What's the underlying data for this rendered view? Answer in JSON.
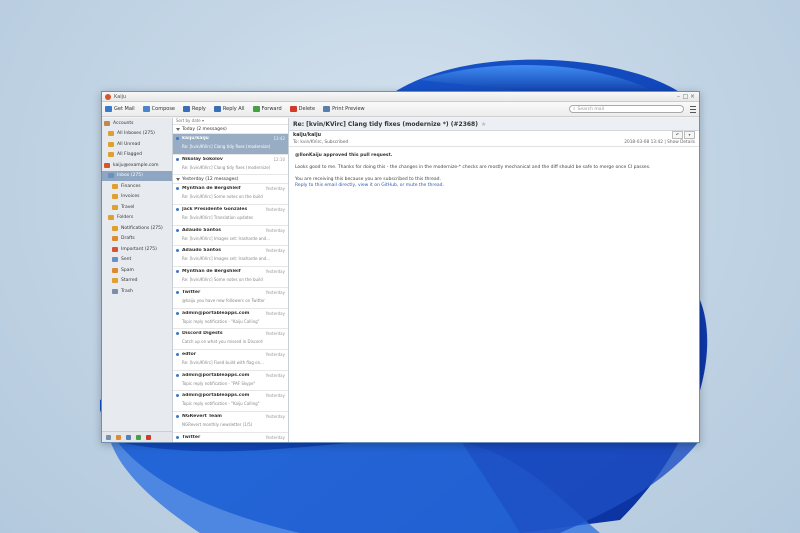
{
  "window": {
    "title": "Kaiju"
  },
  "toolbar": {
    "buttons": [
      "Get Mail",
      "Compose",
      "Reply",
      "Reply All",
      "Forward",
      "Delete",
      "Print Preview"
    ],
    "search_placeholder": "Search mail"
  },
  "folders": {
    "items": [
      {
        "label": "Accounts",
        "icon": "accounts-icon",
        "color": "#c0894a"
      },
      {
        "label": "All Inboxes (275)",
        "icon": "inbox-icon",
        "color": "#e0a030"
      },
      {
        "label": "All Unread",
        "icon": "unread-icon",
        "color": "#e0a030"
      },
      {
        "label": "All Flagged",
        "icon": "flag-icon",
        "color": "#e0a030"
      },
      {
        "label": "kaiju@example.com",
        "icon": "mail-account-icon",
        "color": "#d9532c"
      },
      {
        "label": "Inbox (275)",
        "icon": "inbox-icon",
        "color": "#6b8fc0",
        "selected": true
      },
      {
        "label": "Finances",
        "icon": "folder-icon",
        "color": "#e0a030"
      },
      {
        "label": "Invoices",
        "icon": "folder-icon",
        "color": "#e0a030"
      },
      {
        "label": "Travel",
        "icon": "folder-icon",
        "color": "#e0a030"
      },
      {
        "label": "Folders",
        "icon": "folder-icon",
        "color": "#e0a030"
      },
      {
        "label": "Notifications (275)",
        "icon": "folder-icon",
        "color": "#e0a030"
      },
      {
        "label": "Drafts",
        "icon": "drafts-icon",
        "color": "#e08a30"
      },
      {
        "label": "Important (275)",
        "icon": "important-icon",
        "color": "#d9532c"
      },
      {
        "label": "Sent",
        "icon": "sent-icon",
        "color": "#6b8fc0"
      },
      {
        "label": "Spam",
        "icon": "spam-icon",
        "color": "#e08a30"
      },
      {
        "label": "Starred",
        "icon": "star-icon",
        "color": "#e0a030"
      },
      {
        "label": "Trash",
        "icon": "trash-icon",
        "color": "#7a8fa8"
      }
    ]
  },
  "list": {
    "sort_label": "Sort by date ▾",
    "groups": [
      {
        "label": "Today (2 messages)",
        "messages": [
          {
            "sender": "kaiju/kaiju",
            "date": "13:42",
            "subject": "Re: [kvin/KVirc] Clang tidy fixes (modernize)",
            "selected": true
          },
          {
            "sender": "Nikolay Sokolov",
            "date": "12:10",
            "subject": "Re: [kvin/KVirc] Clang tidy fixes (modernize)"
          }
        ]
      },
      {
        "label": "Yesterday (12 messages)",
        "messages": [
          {
            "sender": "Mynthan de Bergshleif",
            "date": "Yesterday",
            "subject": "Re: [kvin/KVirc] Some notes on the build"
          },
          {
            "sender": "Jack Presidente Gonzales",
            "date": "Yesterday",
            "subject": "Re: [kvin/KVirc] Translation updates"
          },
          {
            "sender": "Adaudo Santos",
            "date": "Yesterday",
            "subject": "Re: [kvin/KVirc] Images set: Irasharde and..."
          },
          {
            "sender": "Adaudo Santos",
            "date": "Yesterday",
            "subject": "Re: [kvin/KVirc] Images set: Irasharde and..."
          },
          {
            "sender": "Mynthan de Bergshleif",
            "date": "Yesterday",
            "subject": "Re: [kvin/KVirc] Some notes on the build"
          },
          {
            "sender": "Twitter",
            "date": "Yesterday",
            "subject": "@kaiju you have new followers on Twitter"
          },
          {
            "sender": "admin@portableapps.com",
            "date": "Yesterday",
            "subject": "Topic reply notification - \"Kaiju Calling\""
          },
          {
            "sender": "Discord Digests",
            "date": "Yesterday",
            "subject": "Catch up on what you missed in Discord"
          },
          {
            "sender": "edtor",
            "date": "Yesterday",
            "subject": "Re: [kvin/KVirc] Fixed build with flag on..."
          },
          {
            "sender": "admin@portableapps.com",
            "date": "Yesterday",
            "subject": "Topic reply notification - \"PAF Skype\""
          },
          {
            "sender": "admin@portableapps.com",
            "date": "Yesterday",
            "subject": "Topic reply notification - \"Kaiju Calling\""
          },
          {
            "sender": "NGRevert Team",
            "date": "Yesterday",
            "subject": "NGRevert monthly newsletter (1/5)"
          },
          {
            "sender": "Twitter",
            "date": "Yesterday",
            "subject": "@kaiju you have new followers"
          }
        ]
      }
    ]
  },
  "reader": {
    "subject": "Re: [kvin/KVirc] Clang tidy fixes (modernize *) (#2368)",
    "from": "kaiju/kaiju",
    "to": "To: kvin/KVirc, Subscribed",
    "date": "2018-03-08 13:42 | Show Details",
    "body_bold": "@IlonKaiju approved this pull request.",
    "body_1": "Looks good to me. Thanks for doing this - the changes in the modernize-* checks are mostly mechanical and the diff should be safe to merge once CI passes.",
    "body_2": "You are receiving this because you are subscribed to this thread.",
    "body_3": "Reply to this email directly, view it on GitHub, or mute the thread."
  }
}
